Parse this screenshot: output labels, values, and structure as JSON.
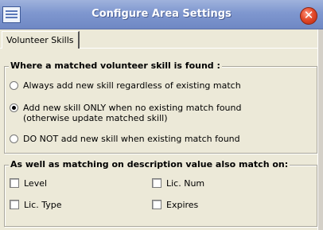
{
  "window": {
    "title": "Configure Area Settings",
    "close_glyph": "✕"
  },
  "tabs": [
    {
      "label": "Volunteer Skills"
    }
  ],
  "match_group": {
    "legend": "Where a matched volunteer skill is found :",
    "options": [
      {
        "label": "Always add new skill regardless of existing match",
        "selected": false
      },
      {
        "label": "Add new skill ONLY when no existing match found",
        "label2": "(otherwise update matched skill)",
        "selected": true
      },
      {
        "label": "DO NOT add new skill when existing match found",
        "selected": false
      }
    ]
  },
  "also_match_group": {
    "legend": "As well as matching on description value also match on:",
    "checkboxes": [
      {
        "label": "Level",
        "checked": false
      },
      {
        "label": "Lic. Num",
        "checked": false
      },
      {
        "label": "Lic. Type",
        "checked": false
      },
      {
        "label": "Expires",
        "checked": false
      }
    ]
  }
}
